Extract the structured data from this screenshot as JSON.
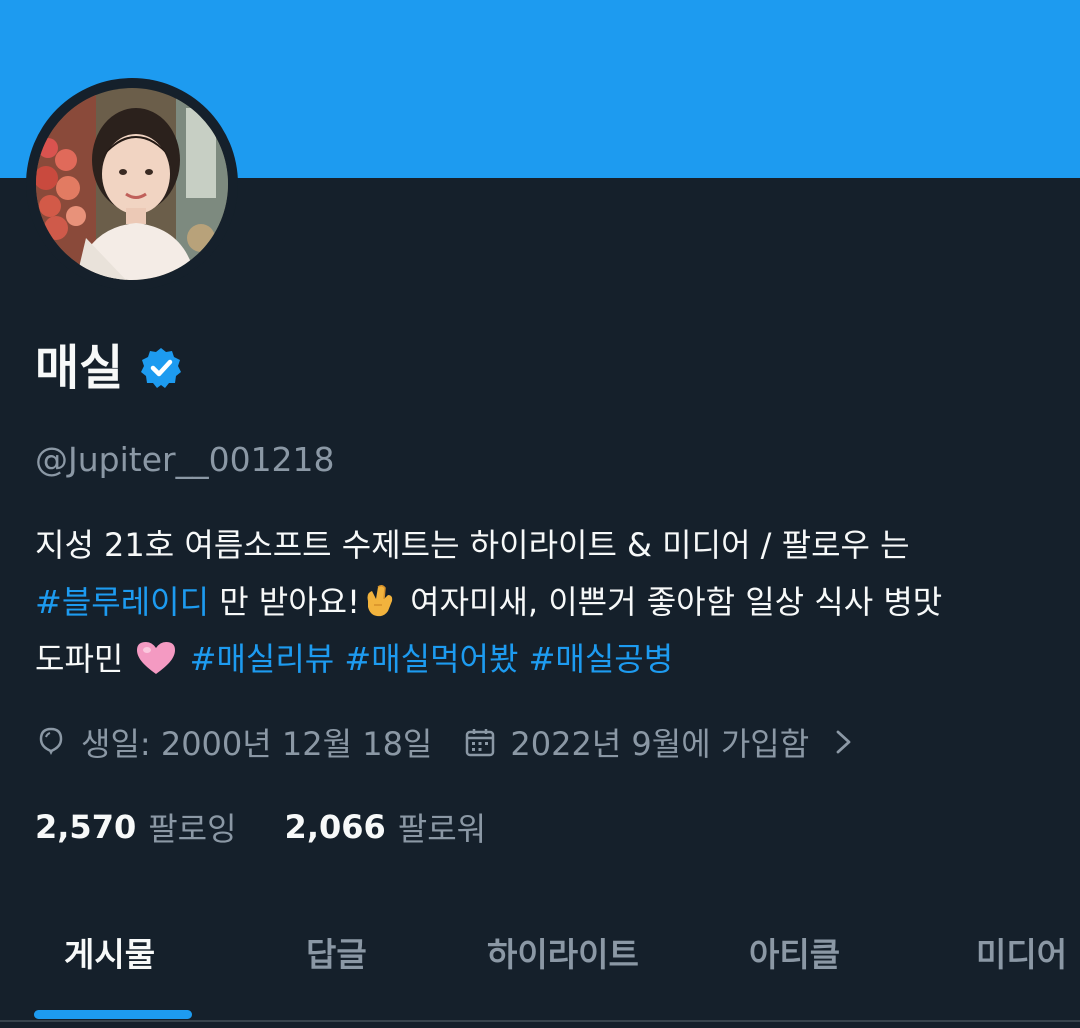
{
  "profile": {
    "display_name": "매실",
    "verified": true,
    "handle": "@Jupiter__001218",
    "bio": {
      "line1": "지성 21호 여름소프트 수제트는 하이라이트 & 미디어 /  팔로우 는",
      "line2_hashtag": "#블루레이디",
      "line2_text": " 만 받아요!",
      "line2_after_emoji": " 여자미새, 이쁜거 좋아함 일상 식사 병맛",
      "line3_text": "도파민",
      "hashtags": [
        "#매실리뷰",
        "#매실먹어봤",
        "#매실공병"
      ]
    },
    "birthday": "생일: 2000년 12월 18일",
    "joined": "2022년 9월에 가입함",
    "following_count": "2,570",
    "following_label": "팔로잉",
    "followers_count": "2,066",
    "followers_label": "팔로워"
  },
  "tabs": [
    {
      "label": "게시물",
      "active": true
    },
    {
      "label": "답글",
      "active": false
    },
    {
      "label": "하이라이트",
      "active": false
    },
    {
      "label": "아티클",
      "active": false
    },
    {
      "label": "미디어",
      "active": false
    }
  ],
  "icons": {
    "verified": "verified-badge-icon",
    "birthday": "balloon-icon",
    "joined": "calendar-icon",
    "expand": "chevron-right-icon",
    "hand_emoji": "call-me-hand-emoji",
    "heart_emoji": "pink-heart-emoji"
  },
  "colors": {
    "background": "#15202b",
    "banner": "#1d9bf0",
    "accent": "#1d9bf0",
    "secondary_text": "#8b98a5",
    "primary_text": "#f7f9f9"
  }
}
